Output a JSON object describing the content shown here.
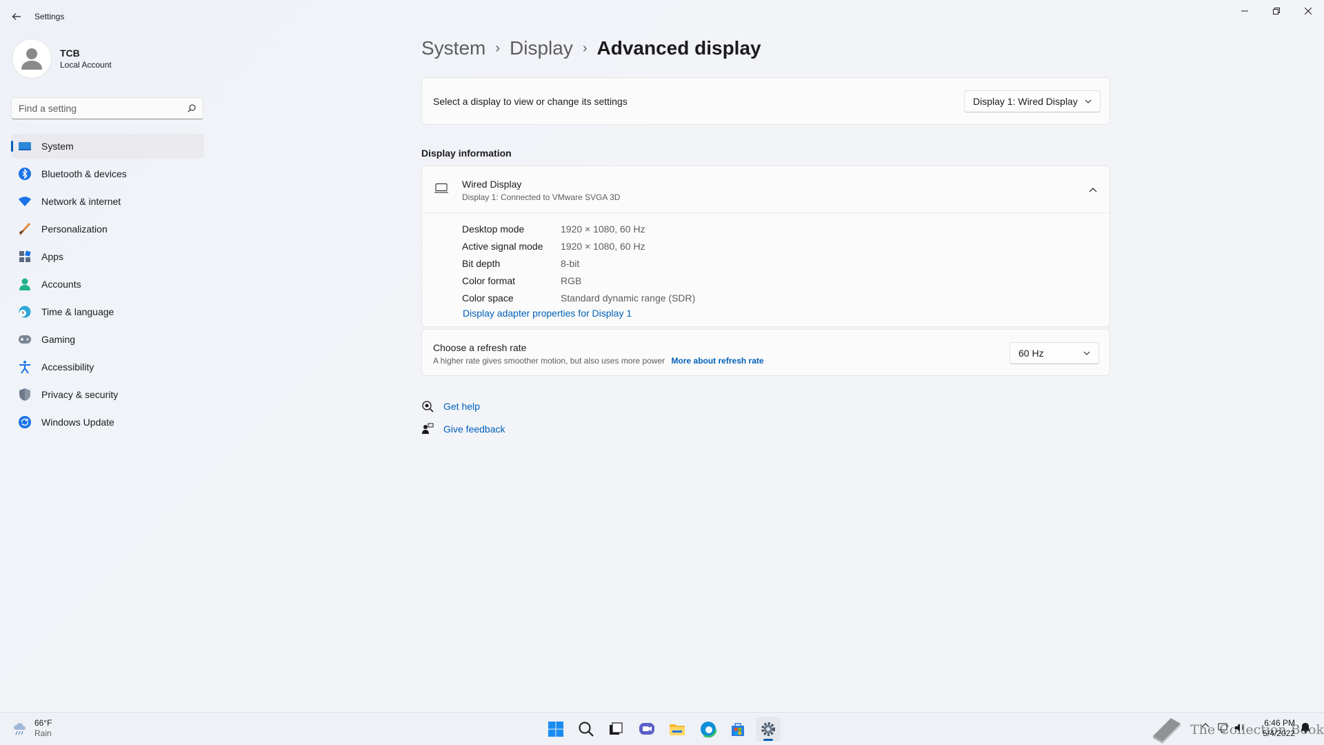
{
  "window": {
    "title": "Settings",
    "back_icon": "arrow-left-icon",
    "minimize_icon": "minimize-icon",
    "maximize_icon": "restore-icon",
    "close_icon": "close-icon"
  },
  "profile": {
    "name": "TCB",
    "account_type": "Local Account"
  },
  "search": {
    "placeholder": "Find a setting",
    "icon": "search-icon"
  },
  "sidebar": {
    "items": [
      {
        "label": "System",
        "icon": "monitor-icon",
        "active": true
      },
      {
        "label": "Bluetooth & devices",
        "icon": "bluetooth-icon"
      },
      {
        "label": "Network & internet",
        "icon": "wifi-icon"
      },
      {
        "label": "Personalization",
        "icon": "brush-icon"
      },
      {
        "label": "Apps",
        "icon": "apps-icon"
      },
      {
        "label": "Accounts",
        "icon": "person-icon"
      },
      {
        "label": "Time & language",
        "icon": "clock-globe-icon"
      },
      {
        "label": "Gaming",
        "icon": "gamepad-icon"
      },
      {
        "label": "Accessibility",
        "icon": "accessibility-icon"
      },
      {
        "label": "Privacy & security",
        "icon": "shield-icon"
      },
      {
        "label": "Windows Update",
        "icon": "update-icon"
      }
    ]
  },
  "breadcrumb": {
    "items": [
      "System",
      "Display"
    ],
    "current": "Advanced display"
  },
  "display_select": {
    "label": "Select a display to view or change its settings",
    "selected": "Display 1: Wired Display"
  },
  "display_info": {
    "section_title": "Display information",
    "title": "Wired Display",
    "subtitle": "Display 1: Connected to VMware SVGA 3D",
    "rows": [
      {
        "key": "Desktop mode",
        "value": "1920 × 1080, 60 Hz"
      },
      {
        "key": "Active signal mode",
        "value": "1920 × 1080, 60 Hz"
      },
      {
        "key": "Bit depth",
        "value": "8-bit"
      },
      {
        "key": "Color format",
        "value": "RGB"
      },
      {
        "key": "Color space",
        "value": "Standard dynamic range (SDR)"
      }
    ],
    "adapter_link": "Display adapter properties for Display 1"
  },
  "refresh_rate": {
    "title": "Choose a refresh rate",
    "description": "A higher rate gives smoother motion, but also uses more power",
    "more_link": "More about refresh rate",
    "selected": "60 Hz"
  },
  "help": {
    "get_help": "Get help",
    "give_feedback": "Give feedback"
  },
  "taskbar": {
    "weather": {
      "temp": "66°F",
      "condition": "Rain"
    },
    "apps": [
      "windows-start-icon",
      "search-icon",
      "task-view-icon",
      "chat-icon",
      "file-explorer-icon",
      "edge-icon",
      "store-icon",
      "settings-icon"
    ],
    "watermark": "The Collection Book",
    "clock": {
      "time": "6:46 PM",
      "date": "5/4/2022"
    }
  },
  "colors": {
    "accent": "#005fb8",
    "background": "#f3f4f8",
    "card": "#fbfbfb"
  }
}
